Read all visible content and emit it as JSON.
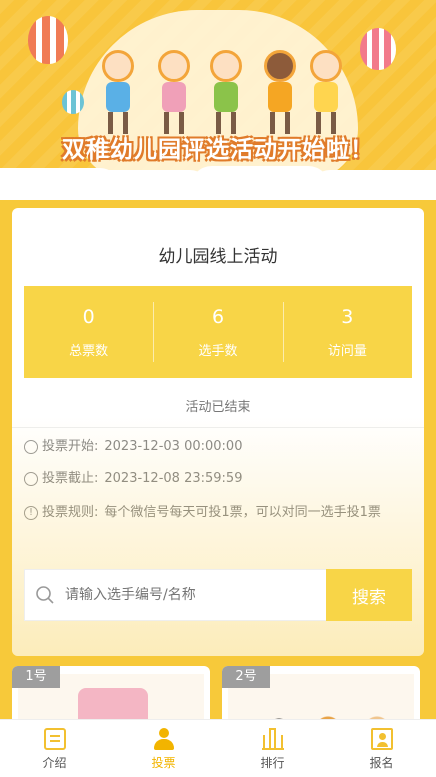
{
  "banner": {
    "title": "双稚幼儿园评选活动开始啦！"
  },
  "activity": {
    "title": "幼儿园线上活动",
    "stats": [
      {
        "value": "0",
        "label": "总票数"
      },
      {
        "value": "6",
        "label": "选手数"
      },
      {
        "value": "3",
        "label": "访问量"
      }
    ],
    "status": "活动已结束",
    "info": {
      "start_label": "投票开始:",
      "start_value": "2023-12-03 00:00:00",
      "end_label": "投票截止:",
      "end_value": "2023-12-08 23:59:59",
      "rule_label": "投票规则:",
      "rule_value": "每个微信号每天可投1票，可以对同一选手投1票"
    }
  },
  "search": {
    "placeholder": "请输入选手编号/名称",
    "button": "搜索"
  },
  "contestants": [
    {
      "tag": "1号"
    },
    {
      "tag": "2号"
    }
  ],
  "tabbar": {
    "items": [
      {
        "label": "介绍",
        "icon": "document-icon"
      },
      {
        "label": "投票",
        "icon": "person-icon"
      },
      {
        "label": "排行",
        "icon": "bar-chart-icon"
      },
      {
        "label": "报名",
        "icon": "id-card-icon"
      }
    ],
    "active_color": "#f2b400"
  },
  "colors": {
    "accent": "#f8d547",
    "background": "#f7c93a"
  }
}
